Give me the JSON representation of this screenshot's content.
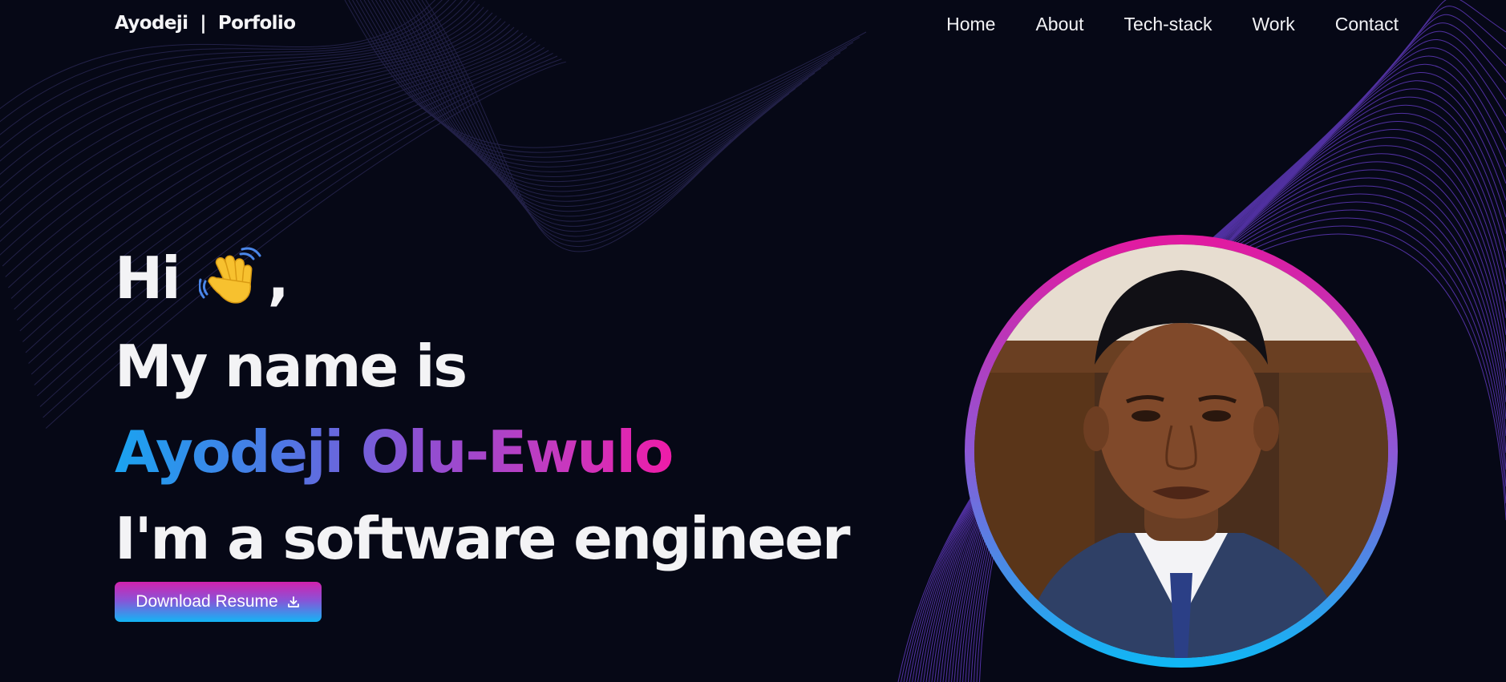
{
  "header": {
    "brand": "Ayodeji  |  Porfolio",
    "nav": [
      {
        "label": "Home"
      },
      {
        "label": "About"
      },
      {
        "label": "Tech-stack"
      },
      {
        "label": "Work"
      },
      {
        "label": "Contact"
      }
    ]
  },
  "hero": {
    "greeting_prefix": "Hi",
    "greeting_icon": "waving-hand-icon",
    "greeting_suffix": ",",
    "intro": "My name is",
    "name": "Ayodeji Olu-Ewulo",
    "role": "I'm a software engineer",
    "download_label": "Download Resume",
    "download_icon": "download-icon"
  },
  "colors": {
    "background": "#060816",
    "accent_blue": "#12b6f5",
    "accent_purple": "#8b52d6",
    "accent_pink": "#e3199f"
  }
}
